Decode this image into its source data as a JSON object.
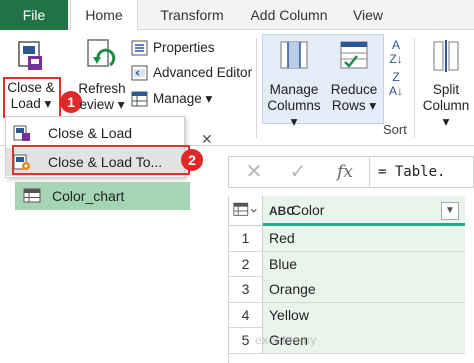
{
  "tabs": {
    "file": "File",
    "home": "Home",
    "transform": "Transform",
    "add_column": "Add Column",
    "view": "View"
  },
  "ribbon": {
    "close_load": "Close &",
    "close_load_2": "Load",
    "refresh": "Refresh",
    "refresh_2": "eview",
    "properties": "Properties",
    "advanced_editor": "Advanced Editor",
    "manage": "Manage",
    "manage_columns": "Manage",
    "manage_columns_2": "Columns",
    "reduce_rows": "Reduce",
    "reduce_rows_2": "Rows",
    "sort": "Sort",
    "split_column": "Split",
    "split_column_2": "Column"
  },
  "badges": {
    "one": "1",
    "two": "2"
  },
  "menu": {
    "items": [
      {
        "label": "Close & Load"
      },
      {
        "label": "Close & Load To..."
      }
    ]
  },
  "queries": {
    "selected": "Color_chart"
  },
  "formula_bar": {
    "cancel": "✕",
    "confirm": "✓",
    "fx": "fx",
    "value": "= Table."
  },
  "table": {
    "type_label": "ABC",
    "column": "Color",
    "rows": [
      {
        "num": "1",
        "value": "Red"
      },
      {
        "num": "2",
        "value": "Blue"
      },
      {
        "num": "3",
        "value": "Orange"
      },
      {
        "num": "4",
        "value": "Yellow"
      },
      {
        "num": "5",
        "value": "Green"
      }
    ]
  },
  "watermark": "exceldemy",
  "colors": {
    "file_tab": "#217346",
    "highlight": "#e03030",
    "selected_query": "#a6d5b6",
    "column_fill": "#e8f4ec"
  }
}
